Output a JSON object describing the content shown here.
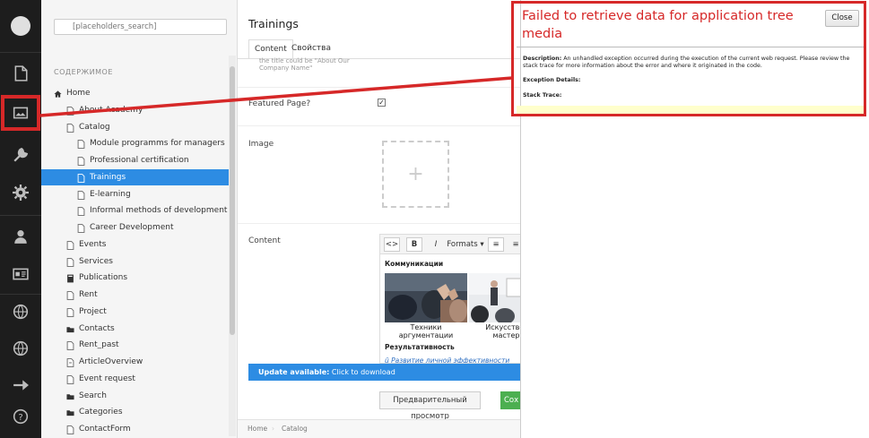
{
  "search": {
    "placeholder": "[placeholders_search]"
  },
  "tree": {
    "section_label": "СОДЕРЖИМОЕ",
    "items": [
      {
        "label": "Home",
        "icon": "home-icon",
        "level": 0
      },
      {
        "label": "About Academy",
        "icon": "document-icon",
        "level": 1
      },
      {
        "label": "Catalog",
        "icon": "document-icon",
        "level": 1
      },
      {
        "label": "Module programms for managers",
        "icon": "document-icon",
        "level": 2
      },
      {
        "label": "Professional certification",
        "icon": "document-icon",
        "level": 2
      },
      {
        "label": "Trainings",
        "icon": "document-icon",
        "level": 2,
        "selected": true
      },
      {
        "label": "E-learning",
        "icon": "document-icon",
        "level": 2
      },
      {
        "label": "Informal methods of development",
        "icon": "document-icon",
        "level": 2
      },
      {
        "label": "Career Development",
        "icon": "document-icon",
        "level": 2
      },
      {
        "label": "Events",
        "icon": "document-icon",
        "level": 1
      },
      {
        "label": "Services",
        "icon": "document-icon",
        "level": 1
      },
      {
        "label": "Publications",
        "icon": "book-icon",
        "level": 1
      },
      {
        "label": "Rent",
        "icon": "document-icon",
        "level": 1
      },
      {
        "label": "Project",
        "icon": "document-icon",
        "level": 1
      },
      {
        "label": "Contacts",
        "icon": "folder-icon",
        "level": 1
      },
      {
        "label": "Rent_past",
        "icon": "document-icon",
        "level": 1
      },
      {
        "label": "ArticleOverview",
        "icon": "document-link-icon",
        "level": 1
      },
      {
        "label": "Event request",
        "icon": "document-icon",
        "level": 1
      },
      {
        "label": "Search",
        "icon": "folder-icon",
        "level": 1
      },
      {
        "label": "Categories",
        "icon": "folder-icon",
        "level": 1
      },
      {
        "label": "ContactForm",
        "icon": "document-icon",
        "level": 1
      }
    ]
  },
  "editor": {
    "title": "Trainings",
    "tabs": [
      {
        "label": "Content"
      },
      {
        "label": "Свойства"
      }
    ],
    "hint": "the title could be \"About Our Company Name\"",
    "fields": {
      "featured_label": "Featured Page?",
      "featured_checked": true,
      "image_label": "Image",
      "image_placeholder": "+",
      "content_label": "Content"
    },
    "rte": {
      "toolbar": {
        "code": "<>",
        "bold": "B",
        "italic": "I",
        "formats": "Formats",
        "align": "≡"
      },
      "heading_1": "Коммуникации",
      "caption_1_line1": "Техники",
      "caption_1_line2": "аргументации",
      "caption_2_line1": "Искусство ор",
      "caption_2_line2": "мастерст",
      "heading_2": "Результативность",
      "link": "Развитие личной эффективности"
    },
    "update": {
      "bold": "Update available:",
      "rest": " Click to download"
    },
    "preview_label": "Предварительный просмотр",
    "save_label": "Сох",
    "breadcrumb": [
      "Home",
      "Catalog"
    ]
  },
  "error": {
    "title": "Failed to retrieve data for application tree media",
    "close_label": "Close",
    "description_label": "Description:",
    "description_text": " An unhandled exception occurred during the execution of the current web request. Please review the stack trace for more information about the error and where it originated in the code.",
    "exception_label": "Exception Details:",
    "stack_label": "Stack Trace:"
  },
  "colors": {
    "accent": "#2d8ce3",
    "error_red": "#d62828",
    "rail_bg": "#1d1d1d",
    "save_green": "#4caf50"
  }
}
